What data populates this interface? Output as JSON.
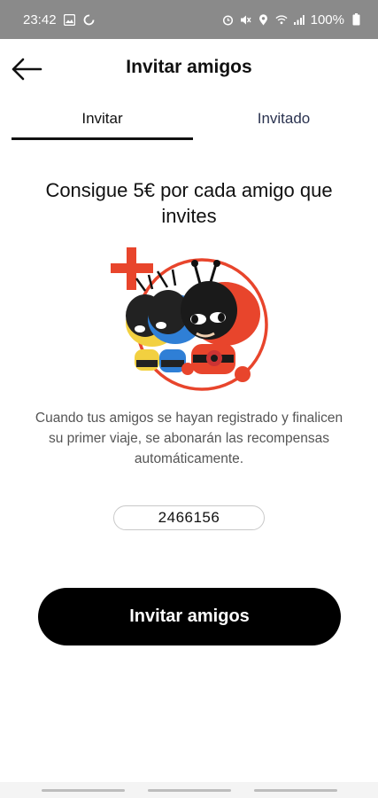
{
  "status_bar": {
    "time": "23:42",
    "battery": "100%"
  },
  "header": {
    "title": "Invitar amigos"
  },
  "tabs": [
    {
      "label": "Invitar",
      "selected": true
    },
    {
      "label": "Invitado",
      "selected": false
    }
  ],
  "main": {
    "headline": "Consigue 5€ por cada amigo que invites",
    "description": "Cuando tus amigos se hayan registrado y finalicen su primer viaje, se abonarán las recompensas automáticamente.",
    "invite_code": "2466156",
    "invite_button_label": "Invitar amigos"
  },
  "colors": {
    "accent_red": "#e8452c",
    "button_bg": "#000000",
    "status_bar_bg": "#8a8a8a"
  }
}
